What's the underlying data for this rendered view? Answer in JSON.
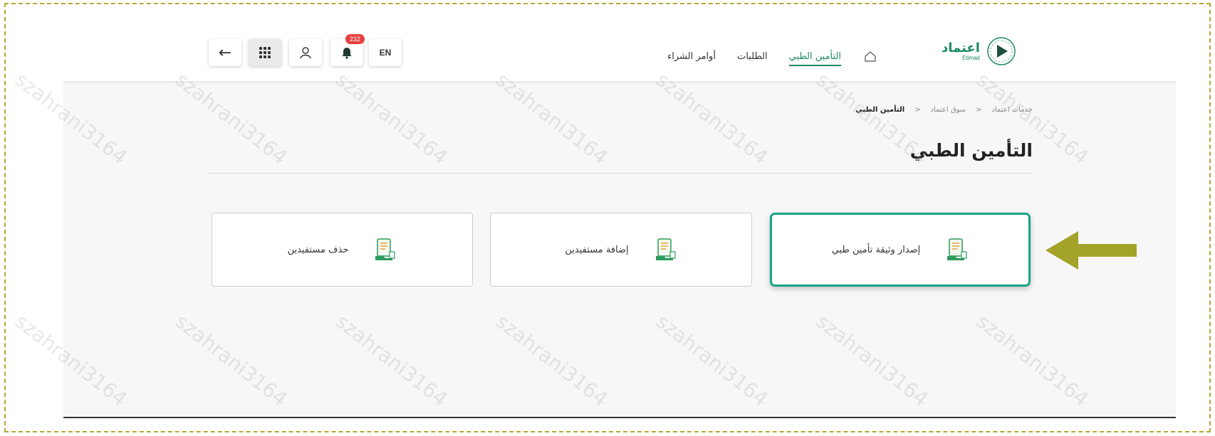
{
  "header": {
    "logo": {
      "ar": "اعتماد",
      "en": "Etimad"
    },
    "nav": [
      {
        "label": "التأمين الطبي",
        "active": true
      },
      {
        "label": "الطلبات",
        "active": false
      },
      {
        "label": "أوامر الشراء",
        "active": false
      }
    ],
    "lang_label": "EN",
    "notification_count": "232",
    "icons": {
      "home": "home-icon",
      "bell": "bell-icon",
      "user": "user-icon",
      "apps": "apps-grid-icon",
      "back": "arrow-left-icon"
    }
  },
  "breadcrumb": [
    "خدمات اعتماد",
    "سوق اعتماد",
    "التأمين الطبي"
  ],
  "page": {
    "title": "التأمين الطبي"
  },
  "cards": [
    {
      "label": "إصدار وثيقة تأمين طبي",
      "icon": "document-icon",
      "selected": true
    },
    {
      "label": "إضافة مستفيدين",
      "icon": "document-icon",
      "selected": false
    },
    {
      "label": "حذف مستفيدين",
      "icon": "document-icon",
      "selected": false
    }
  ],
  "annotation": {
    "arrow_color": "#a3a229",
    "frame_color": "#b3a932"
  },
  "watermark": "szahrani3164",
  "colors": {
    "brand": "#1e8a5e",
    "card_highlight": "#1aa38a",
    "badge": "#e53f3f"
  }
}
